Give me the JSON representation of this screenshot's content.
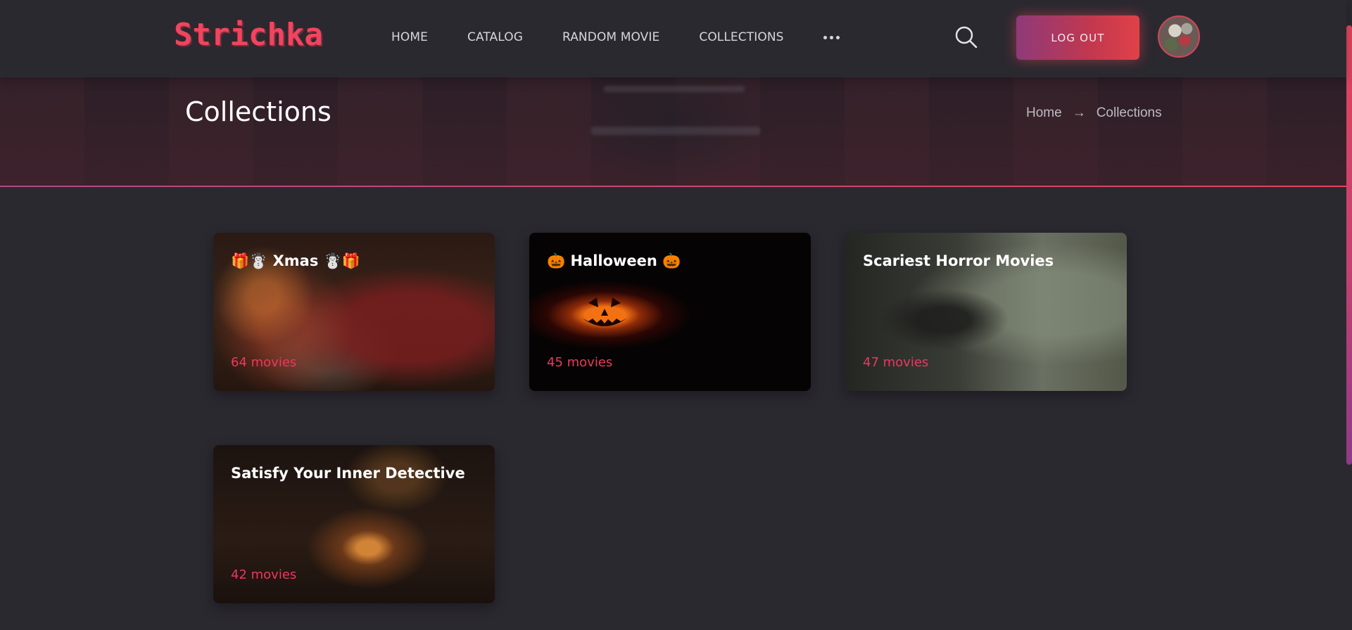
{
  "header": {
    "logo": "Strichka",
    "nav": [
      {
        "label": "HOME"
      },
      {
        "label": "CATALOG"
      },
      {
        "label": "RANDOM MOVIE"
      },
      {
        "label": "COLLECTIONS"
      }
    ],
    "more_icon": "ellipsis-icon",
    "search_icon": "search-icon",
    "logout_label": "LOG OUT"
  },
  "banner": {
    "title": "Collections",
    "breadcrumb": {
      "home": "Home",
      "arrow": "→",
      "current": "Collections"
    }
  },
  "collections": [
    {
      "title": "🎁☃️ Xmas ☃️🎁",
      "count": "64 movies"
    },
    {
      "title": "🎃 Halloween 🎃",
      "count": "45 movies"
    },
    {
      "title": "Scariest Horror Movies",
      "count": "47 movies"
    },
    {
      "title": "Satisfy Your Inner Detective",
      "count": "42 movies"
    }
  ],
  "colors": {
    "accent": "#f0365e",
    "background": "#2b2930",
    "logo": "#f0455e"
  }
}
